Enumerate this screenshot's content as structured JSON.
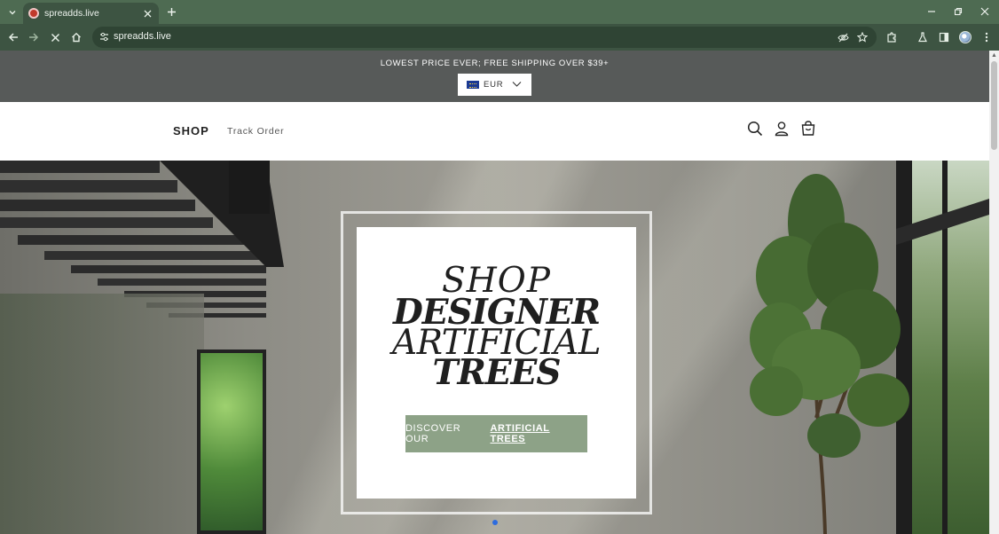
{
  "browser": {
    "tab": {
      "title": "spreadds.live"
    },
    "address_bar": {
      "url": "spreadds.live"
    },
    "icons": {
      "tab_list": "chevron-down-icon",
      "new_tab": "plus-icon",
      "back": "arrow-left-icon",
      "forward": "arrow-right-icon",
      "stop": "close-icon",
      "home": "home-icon",
      "site_info": "tune-icon",
      "eye_off": "eye-off-icon",
      "bookmark": "star-icon",
      "extensions": "puzzle-icon",
      "labs": "flask-icon",
      "side_panel": "side-panel-icon",
      "menu": "kebab-menu-icon"
    },
    "colors": {
      "frame": "#4e6b52",
      "toolbar": "#3d5442"
    }
  },
  "announcement": {
    "text": "LOWEST PRICE EVER; FREE SHIPPING OVER $39+",
    "currency": {
      "selected": "EUR",
      "flag": "eu-flag-icon"
    }
  },
  "header": {
    "nav": {
      "shop": "SHOP",
      "track_order": "Track Order"
    },
    "icons": [
      "search-icon",
      "account-icon",
      "cart-icon"
    ]
  },
  "hero": {
    "headline": {
      "line1": "SHOP",
      "line2": "DESIGNER",
      "line3": "ARTIFICIAL",
      "line4": "TREES"
    },
    "cta": {
      "prefix": "DISCOVER OUR",
      "link": "ARTIFICIAL TREES"
    },
    "colors": {
      "cta_background": "#8da287",
      "slide_dot": "#2d6cdf"
    }
  }
}
